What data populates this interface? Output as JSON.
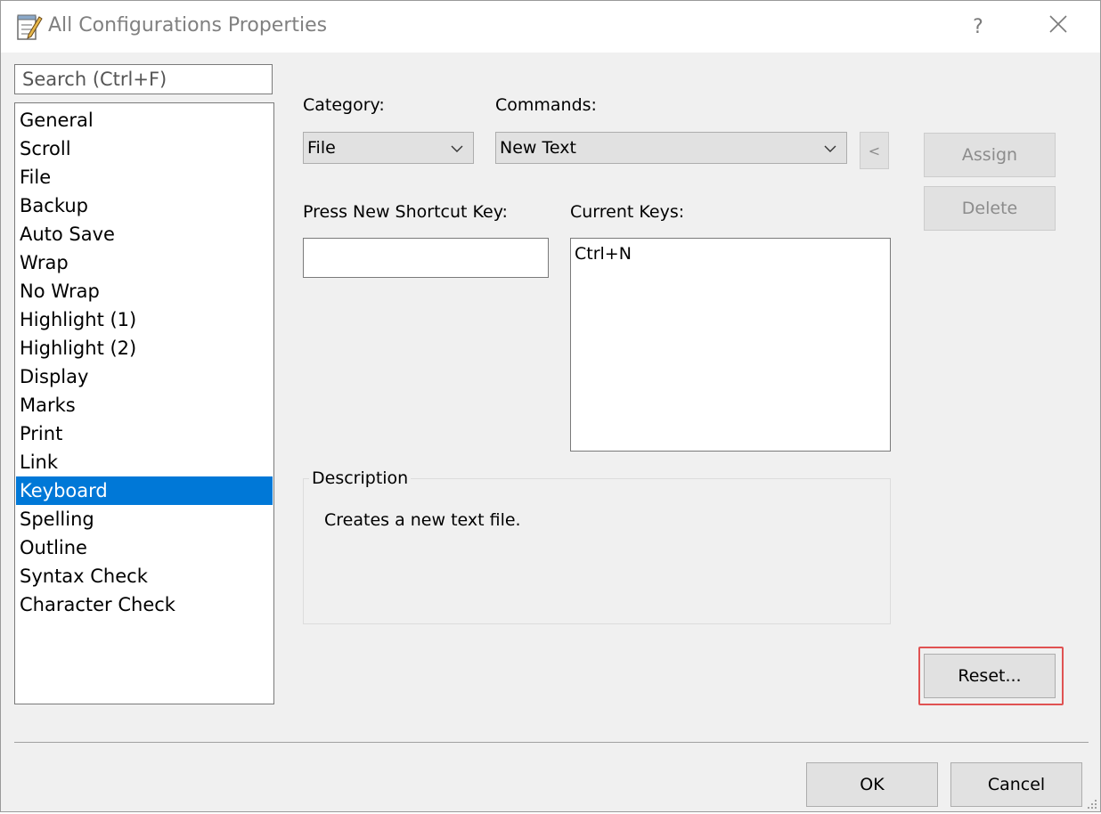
{
  "window": {
    "title": "All Configurations Properties",
    "help_label": "?",
    "close_label": "✕"
  },
  "sidebar": {
    "search_placeholder": "Search (Ctrl+F)",
    "items": [
      {
        "label": "General"
      },
      {
        "label": "Scroll"
      },
      {
        "label": "File"
      },
      {
        "label": "Backup"
      },
      {
        "label": "Auto Save"
      },
      {
        "label": "Wrap"
      },
      {
        "label": "No Wrap"
      },
      {
        "label": "Highlight (1)"
      },
      {
        "label": "Highlight (2)"
      },
      {
        "label": "Display"
      },
      {
        "label": "Marks"
      },
      {
        "label": "Print"
      },
      {
        "label": "Link"
      },
      {
        "label": "Keyboard"
      },
      {
        "label": "Spelling"
      },
      {
        "label": "Outline"
      },
      {
        "label": "Syntax Check"
      },
      {
        "label": "Character Check"
      }
    ],
    "selected_item": "Keyboard"
  },
  "keyboard": {
    "category_label": "Category:",
    "category_value": "File",
    "commands_label": "Commands:",
    "commands_value": "New Text",
    "back_button_label": "<",
    "press_shortcut_label": "Press New Shortcut Key:",
    "shortcut_value": "",
    "current_keys_label": "Current Keys:",
    "current_keys": [
      "Ctrl+N"
    ],
    "assign_label": "Assign",
    "delete_label": "Delete",
    "description_title": "Description",
    "description_text": "Creates a new text file.",
    "reset_label": "Reset..."
  },
  "footer": {
    "ok_label": "OK",
    "cancel_label": "Cancel"
  },
  "colors": {
    "selection": "#0078d7",
    "highlight_box": "#e05252",
    "dialog_bg": "#f0f0f0"
  }
}
